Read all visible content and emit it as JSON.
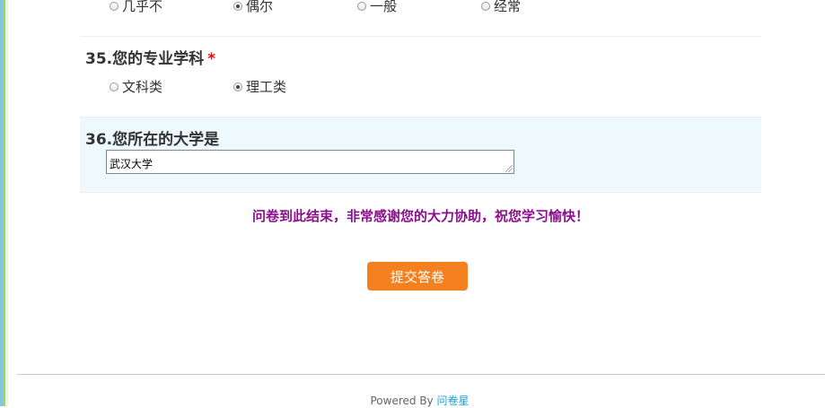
{
  "q34": {
    "options": [
      "几乎不",
      "偶尔",
      "一般",
      "经常"
    ],
    "selected_index": 1
  },
  "q35": {
    "title": "35.您的专业学科",
    "required_mark": "*",
    "options": [
      "文科类",
      "理工类"
    ],
    "selected_index": 1
  },
  "q36": {
    "title": "36.您所在的大学是",
    "answer": "武汉大学"
  },
  "end_message": "问卷到此结束，非常感谢您的大力协助，祝您学习愉快！",
  "submit_label": "提交答卷",
  "footer": {
    "powered_by": "Powered By",
    "brand": "问卷星"
  },
  "colors": {
    "accent_button": "#f5801f",
    "end_message": "#8b0f8b",
    "highlight_bg": "#eef9fd",
    "brand_link": "#1ea0d6"
  }
}
